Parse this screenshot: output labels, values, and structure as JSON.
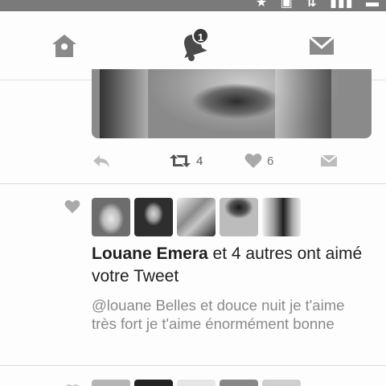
{
  "tabs": {
    "home_icon": "home-icon",
    "notifications_icon": "bell-icon",
    "notifications_badge": "1",
    "messages_icon": "envelope-icon"
  },
  "tweet_actions": {
    "retweet_count": "4",
    "like_count": "6"
  },
  "notification": {
    "user_name": "Louane Emera",
    "message": " et 4 autres ont aimé votre Tweet",
    "tweet_text": "@louane Belles et douce nuit je t'aime très fort je t'aime énormément bonne"
  }
}
